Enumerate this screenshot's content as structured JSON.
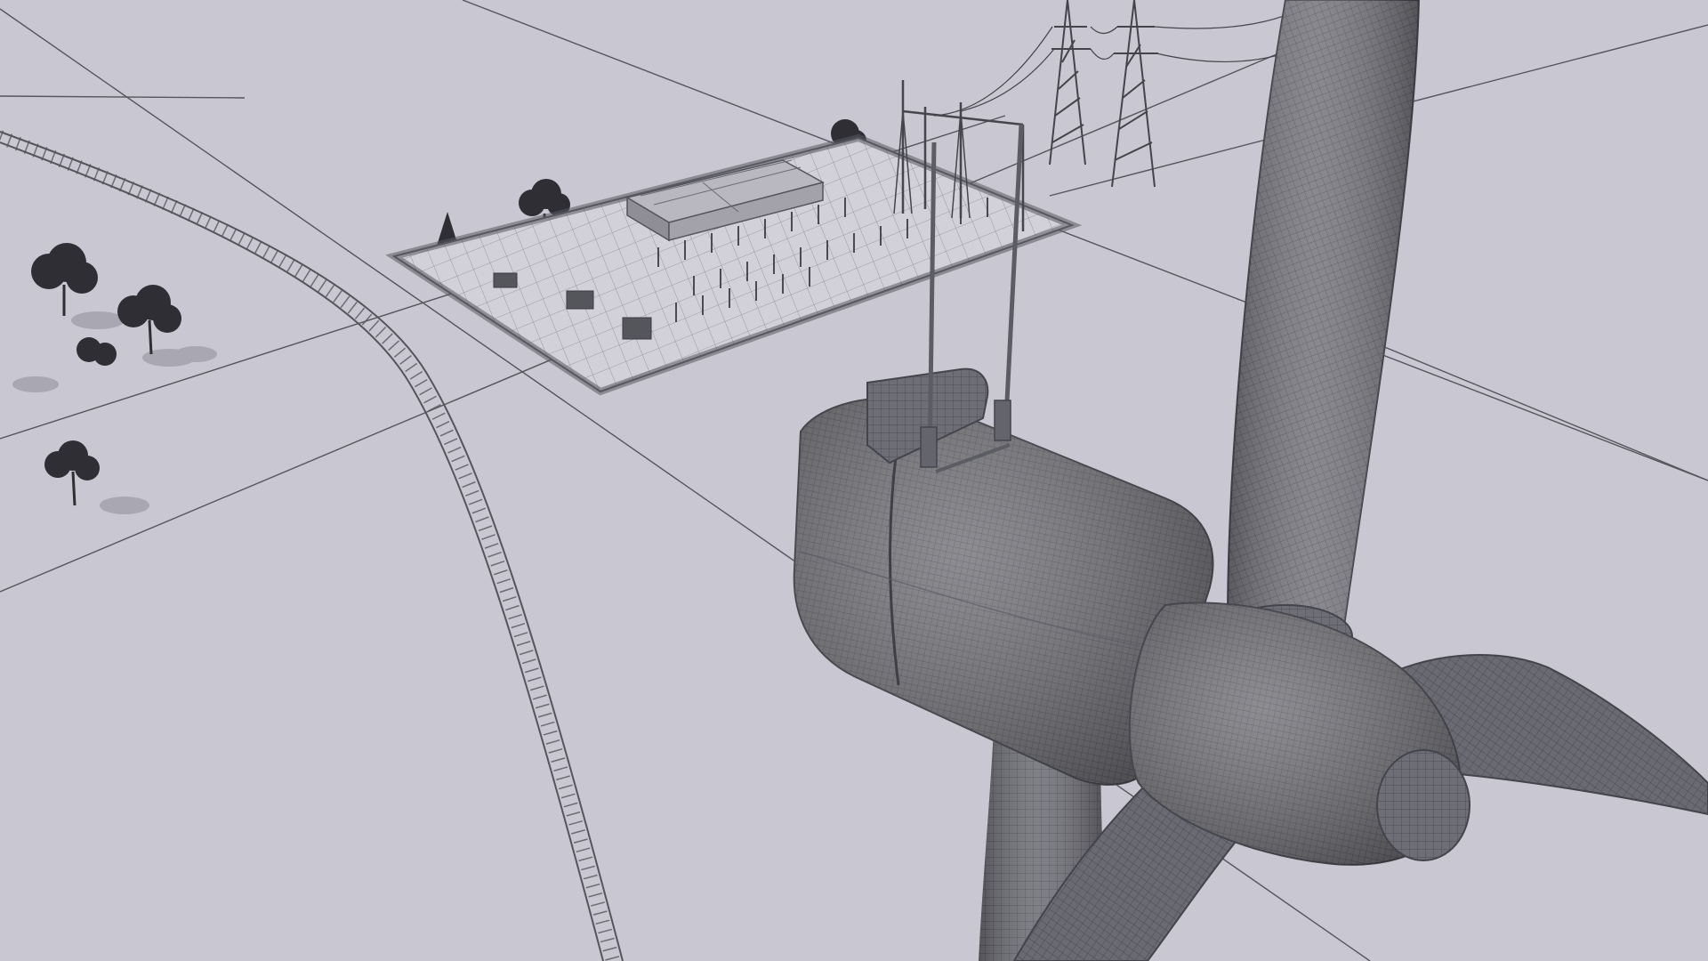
{
  "scene": {
    "subject": "wind-turbine-wireframe-render",
    "colors": {
      "ground": "#c9c7d1",
      "ground_light": "#d3d1da",
      "line": "#5a5a64",
      "mesh": "#6b6b73",
      "mesh_dark": "#4a4a52",
      "mesh_light": "#8d8d95",
      "shadow": "#a9a7b1",
      "tree": "#2e2e34"
    },
    "elements": [
      "railway-track",
      "electrical-substation",
      "transmission-towers",
      "trees",
      "wind-turbine-tower",
      "wind-turbine-nacelle",
      "wind-turbine-hub",
      "wind-turbine-blades",
      "anemometer-masts"
    ]
  }
}
